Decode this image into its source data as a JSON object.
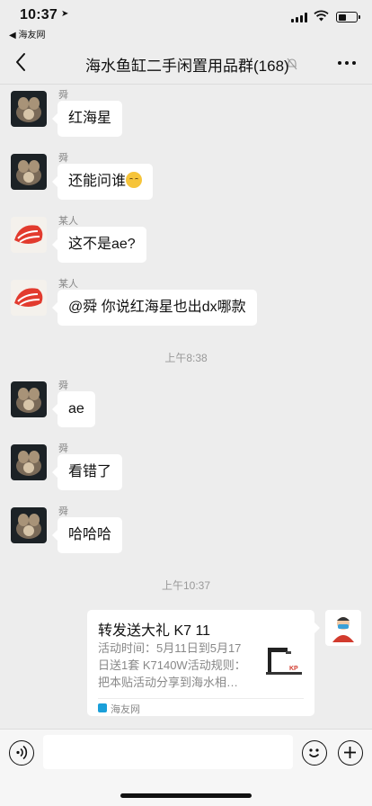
{
  "status_bar": {
    "time": "10:37",
    "back_app": "◀ 海友网"
  },
  "nav": {
    "title": "海水鱼缸二手闲置用品群(168)"
  },
  "messages": [
    {
      "sender": "舜",
      "text": "红海星"
    },
    {
      "sender": "舜",
      "text": "还能问谁"
    },
    {
      "sender": "某人",
      "text": "这不是ae?"
    },
    {
      "sender": "某人",
      "text": "@舜 你说红海星也出dx哪款"
    },
    {
      "sender": "舜",
      "text": "ae"
    },
    {
      "sender": "舜",
      "text": "看错了"
    },
    {
      "sender": "舜",
      "text": "哈哈哈"
    }
  ],
  "timestamps": [
    "上午8:38",
    "上午10:37"
  ],
  "card": {
    "title": "转发送大礼  K7 11",
    "desc": "活动时间：5月11日到5月17日送1套 K7140W活动规则：把本贴活动分享到海水相…",
    "source": "海友网",
    "thumb_label": "KP"
  },
  "input": {
    "placeholder": ""
  }
}
